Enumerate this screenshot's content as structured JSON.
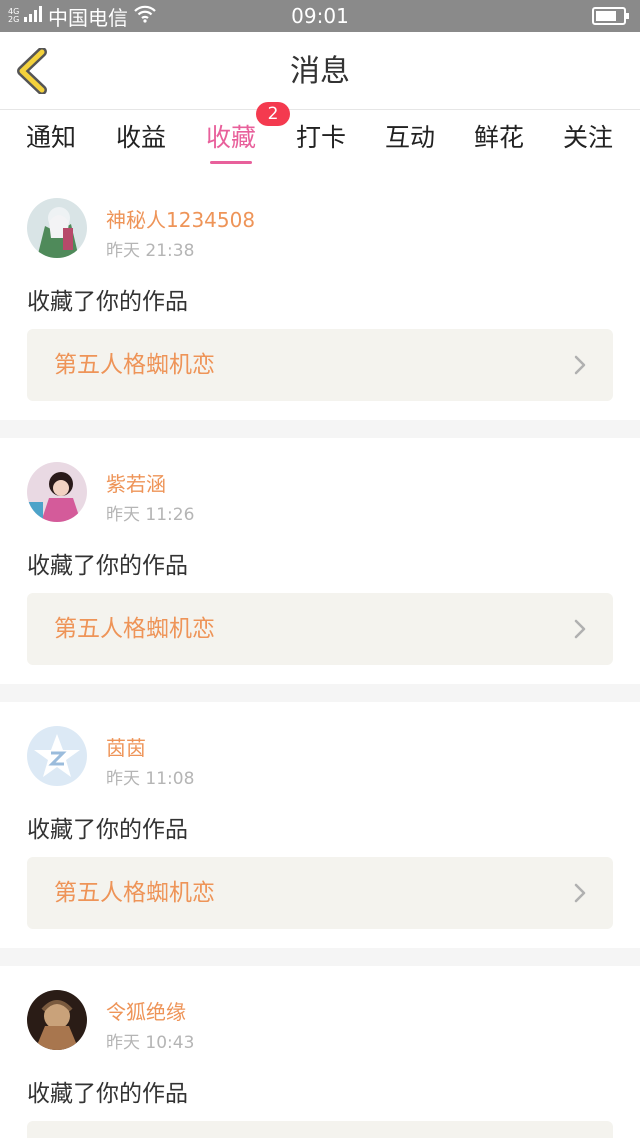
{
  "status_bar": {
    "net_top": "4G",
    "net_bottom": "2G",
    "carrier": "中国电信",
    "time": "09:01",
    "icons": [
      "signal-icon",
      "wifi-icon",
      "battery-icon"
    ]
  },
  "header": {
    "title": "消息",
    "back_icon": "chevron-left-icon"
  },
  "tabs": [
    {
      "label": "通知"
    },
    {
      "label": "收益"
    },
    {
      "label": "收藏",
      "active": true,
      "badge": "2"
    },
    {
      "label": "打卡"
    },
    {
      "label": "互动"
    },
    {
      "label": "鲜花"
    },
    {
      "label": "关注"
    }
  ],
  "messages": [
    {
      "name": "神秘人1234508",
      "time": "昨天 21:38",
      "action": "收藏了你的作品",
      "work": "第五人格蜘机恋"
    },
    {
      "name": "紫若涵",
      "time": "昨天 11:26",
      "action": "收藏了你的作品",
      "work": "第五人格蜘机恋"
    },
    {
      "name": "茵茵",
      "time": "昨天 11:08",
      "action": "收藏了你的作品",
      "work": "第五人格蜘机恋"
    },
    {
      "name": "令狐绝缘",
      "time": "昨天 10:43",
      "action": "收藏了你的作品",
      "work": ""
    }
  ],
  "colors": {
    "accent": "#e8609b",
    "name": "#ee9458",
    "badge": "#f43a4f",
    "status_bar": "#8a8a8a",
    "work_box": "#f4f3ee"
  }
}
